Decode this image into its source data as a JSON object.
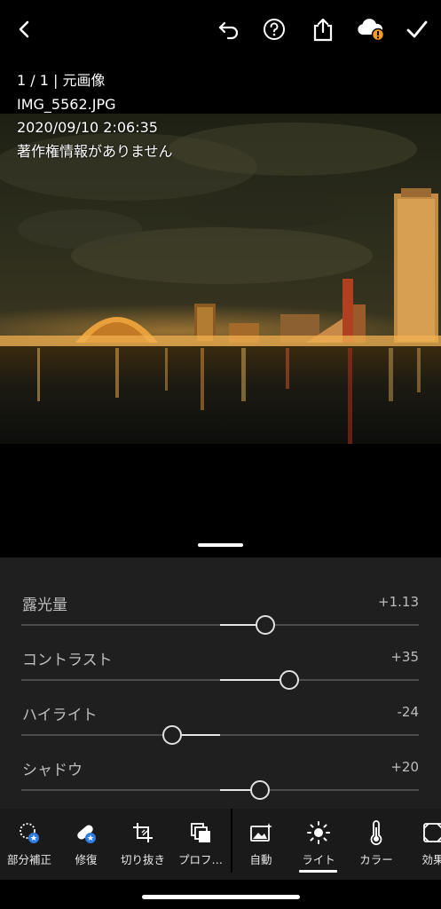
{
  "topbar": {
    "back_icon": "chevron-left-icon",
    "undo_icon": "undo-icon",
    "help_icon": "help-icon",
    "share_icon": "share-icon",
    "cloud_icon": "cloud-warning-icon",
    "done_icon": "checkmark-icon",
    "warning_color": "#f59a23"
  },
  "info": {
    "count_line": "1 / 1 | 元画像",
    "filename": "IMG_5562.JPG",
    "datetime": "2020/09/10 2:06:35",
    "copyright": "著作権情報がありません"
  },
  "adjustments": [
    {
      "label": "露光量",
      "value": "+1.13",
      "level": 1.13,
      "min": -5,
      "max": 5
    },
    {
      "label": "コントラスト",
      "value": "+35",
      "level": 35,
      "min": -100,
      "max": 100
    },
    {
      "label": "ハイライト",
      "value": "-24",
      "level": -24,
      "min": -100,
      "max": 100
    },
    {
      "label": "シャドウ",
      "value": "+20",
      "level": 20,
      "min": -100,
      "max": 100
    }
  ],
  "toolbar": {
    "tools": [
      {
        "label": "部分補正",
        "icon": "selective-adjust-icon"
      },
      {
        "label": "修復",
        "icon": "healing-bandage-icon"
      },
      {
        "label": "切り抜き",
        "icon": "crop-icon"
      },
      {
        "label": "プロフ…",
        "icon": "profiles-icon"
      },
      {
        "label": "自動",
        "icon": "auto-image-icon"
      },
      {
        "label": "ライト",
        "icon": "sun-light-icon"
      },
      {
        "label": "カラー",
        "icon": "thermometer-color-icon"
      },
      {
        "label": "効果",
        "icon": "effects-icon"
      }
    ],
    "active": "ライト",
    "badge_color": "#2f7de0"
  }
}
